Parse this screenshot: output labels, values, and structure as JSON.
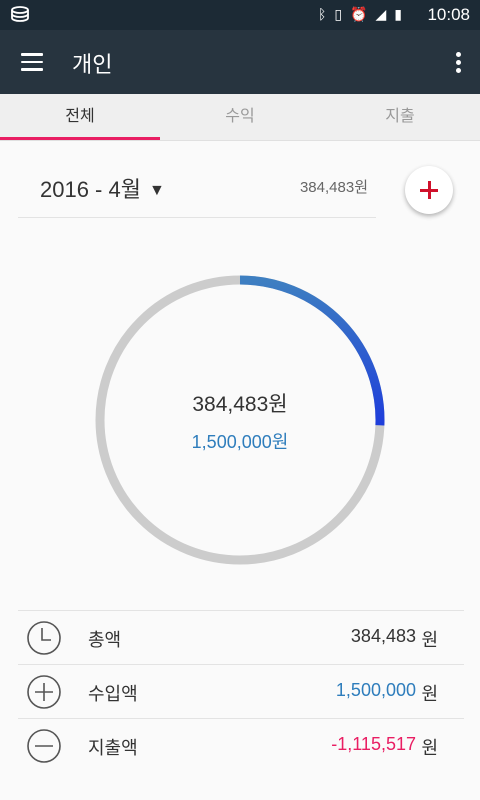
{
  "status_bar": {
    "time": "10:08",
    "icons": [
      "bluetooth-icon",
      "vibrate-icon",
      "alarm-icon",
      "lte-signal-icon",
      "battery-icon"
    ]
  },
  "app_bar": {
    "title": "개인"
  },
  "tabs": [
    {
      "label": "전체",
      "active": true
    },
    {
      "label": "수익",
      "active": false
    },
    {
      "label": "지출",
      "active": false
    }
  ],
  "month": {
    "label": "2016 - 4월",
    "total": "384,483원"
  },
  "ring": {
    "amount": "384,483원",
    "budget": "1,500,000원",
    "fraction": 0.256
  },
  "summary": [
    {
      "label": "총액",
      "value": "384,483",
      "unit": "원"
    },
    {
      "label": "수입액",
      "value": "1,500,000",
      "unit": "원"
    },
    {
      "label": "지출액",
      "value": "-1,115,517",
      "unit": "원"
    }
  ],
  "colors": {
    "status_bar": "#1c2a35",
    "app_bar": "#27343f",
    "accent": "#e91e63",
    "income": "#2e7dbc",
    "expense": "#e91e63",
    "ring_track": "#cccccc",
    "ring_start": "#3e7fc1",
    "ring_end": "#1e3ddb"
  }
}
